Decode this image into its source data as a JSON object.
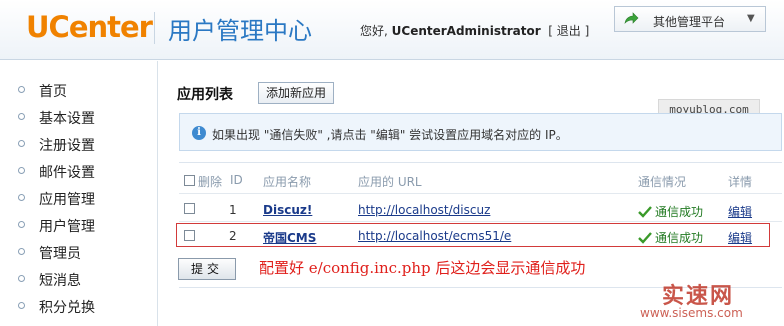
{
  "header": {
    "logo": "UCenter",
    "product": "用户管理中心",
    "greeting": "您好,",
    "username": "UCenterAdministrator",
    "logout": "[ 退出 ]",
    "platform_label": "其他管理平台"
  },
  "sidebar": {
    "items": [
      {
        "label": "首页"
      },
      {
        "label": "基本设置"
      },
      {
        "label": "注册设置"
      },
      {
        "label": "邮件设置"
      },
      {
        "label": "应用管理"
      },
      {
        "label": "用户管理"
      },
      {
        "label": "管理员"
      },
      {
        "label": "短消息"
      },
      {
        "label": "积分兑换"
      }
    ]
  },
  "main": {
    "title": "应用列表",
    "add_button": "添加新应用",
    "tag": "moyublog.com",
    "info": "如果出现 \"通信失败\" ,请点击 \"编辑\" 尝试设置应用域名对应的 IP。",
    "columns": {
      "delete": "删除",
      "id": "ID",
      "name": "应用名称",
      "url": "应用的 URL",
      "status": "通信情况",
      "detail": "详情"
    },
    "rows": [
      {
        "id": "1",
        "name": "Discuz!",
        "url": "http://localhost/discuz",
        "status": "通信成功",
        "edit": "编辑"
      },
      {
        "id": "2",
        "name": "帝国CMS",
        "url": "http://localhost/ecms51/e",
        "status": "通信成功",
        "edit": "编辑"
      }
    ],
    "submit": "提交",
    "annotation": "配置好 e/config.inc.php 后这边会显示通信成功"
  },
  "watermark": {
    "brand": "实速网",
    "url": "www.sisems.com"
  },
  "colors": {
    "logo": "#f08200",
    "product": "#2a78c3",
    "annotation": "#e0201c",
    "success": "#227a22"
  }
}
